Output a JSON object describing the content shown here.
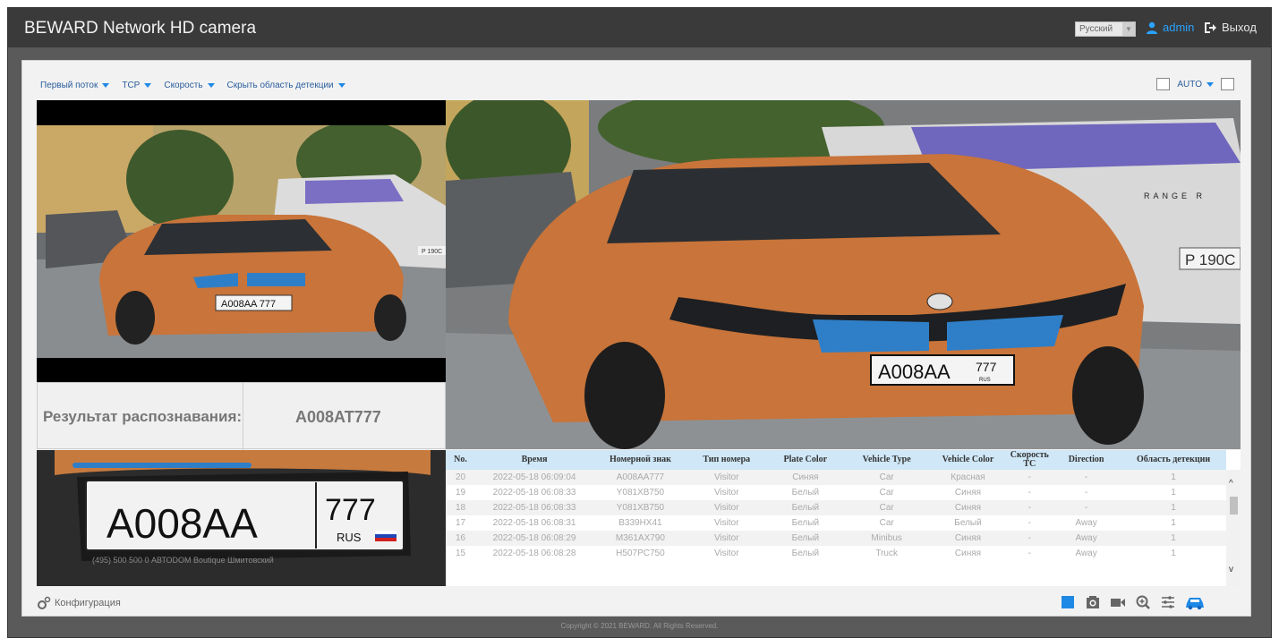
{
  "header": {
    "app_title": "BEWARD Network HD camera",
    "language": "Русский",
    "user": "admin",
    "logout": "Выход"
  },
  "toolbar": {
    "stream": "Первый поток",
    "protocol": "TCP",
    "speed": "Скорость",
    "detection_area": "Скрыть область детекции",
    "aspect": "AUTO"
  },
  "result": {
    "label": "Результат распознавания:",
    "value": "A008AT777"
  },
  "plate": {
    "number": "A008AA",
    "region": "777",
    "country": "RUS",
    "dealer": "(495) 500 500 0   АВТОDOM Boutique Шмитовский"
  },
  "main_plate": {
    "number": "A008AA",
    "region": "777",
    "country": "RUS"
  },
  "left_plate": "A008AA 777",
  "bg_plate": "P 190C",
  "bg_brand": "RANGE R",
  "table": {
    "headers": [
      "No.",
      "Время",
      "Номерной знак",
      "Тип номера",
      "Plate Color",
      "Vehicle Type",
      "Vehicle Color",
      "Скорость ТС",
      "Direction",
      "Область детекции"
    ],
    "rows": [
      [
        "20",
        "2022-05-18 06:09:04",
        "A008AA777",
        "Visitor",
        "Синяя",
        "Car",
        "Красная",
        "-",
        "-",
        "1"
      ],
      [
        "19",
        "2022-05-18 06:08:33",
        "Y081XB750",
        "Visitor",
        "Белый",
        "Car",
        "Синяя",
        "-",
        "-",
        "1"
      ],
      [
        "18",
        "2022-05-18 06:08:33",
        "Y081XB750",
        "Visitor",
        "Белый",
        "Car",
        "Синяя",
        "-",
        "-",
        "1"
      ],
      [
        "17",
        "2022-05-18 06:08:31",
        "B339HX41",
        "Visitor",
        "Белый",
        "Car",
        "Белый",
        "-",
        "Away",
        "1"
      ],
      [
        "16",
        "2022-05-18 06:08:29",
        "M361AX790",
        "Visitor",
        "Белый",
        "Minibus",
        "Синяя",
        "-",
        "Away",
        "1"
      ],
      [
        "15",
        "2022-05-18 06:08:28",
        "H507PC750",
        "Visitor",
        "Белый",
        "Truck",
        "Синяя",
        "-",
        "Away",
        "1"
      ]
    ]
  },
  "footer": {
    "config": "Конфигурация",
    "copyright": "Copyright © 2021 BEWARD. All Rights Reserved."
  },
  "colors": {
    "accent": "#1e88e5",
    "car_orange": "#c8743a",
    "header_bg": "#3a3a3a"
  }
}
